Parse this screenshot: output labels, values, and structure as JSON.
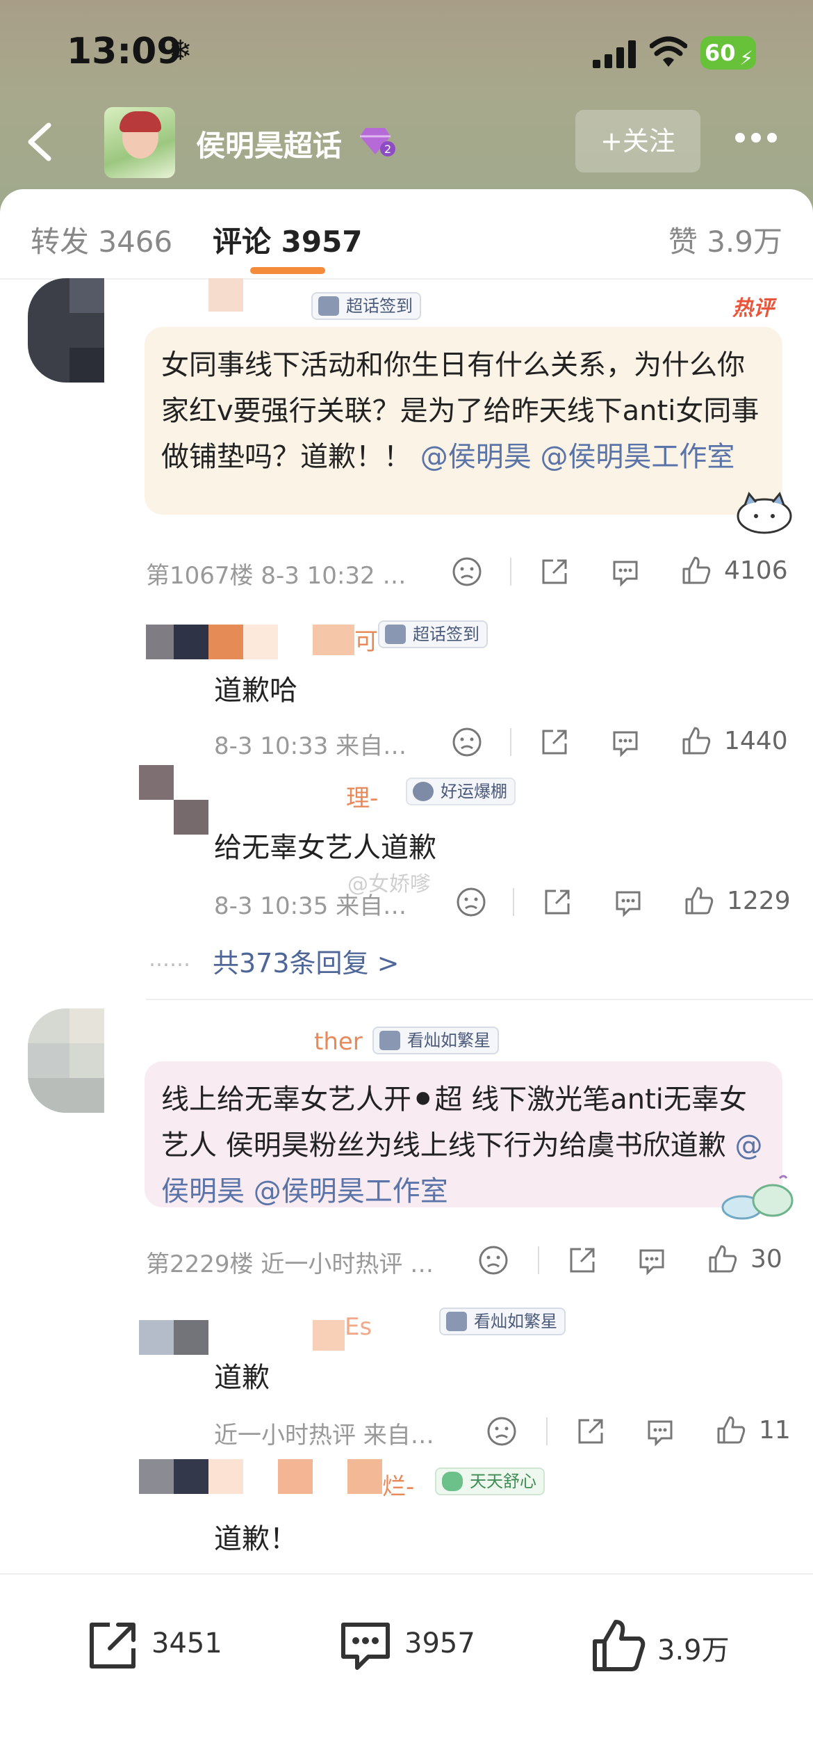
{
  "status_bar": {
    "time": "13:09",
    "battery": "60"
  },
  "header": {
    "title": "侯明昊超话",
    "follow_label": "+关注"
  },
  "tabs": {
    "repost": "转发 3466",
    "comments": "评论 3957",
    "likes": "赞 3.9万"
  },
  "comments": [
    {
      "badge": "超话签到",
      "hot_tag": "热评",
      "text": "女同事线下活动和你生日有什么关系，为什么你家红v要强行关联？是为了给昨天线下anti女同事做铺垫吗？道歉！！",
      "mentions": [
        "@侯明昊",
        "@侯明昊工作室"
      ],
      "meta": "第1067楼 8-3 10:32 …",
      "likes": "4106",
      "replies": [
        {
          "name_fragment": "可-",
          "badge": "超话签到",
          "text": "道歉哈",
          "meta": "8-3 10:33 来自…",
          "likes": "1440"
        },
        {
          "name_fragment": "理-",
          "badge": "好运爆棚",
          "text": "给无辜女艺人道歉",
          "meta": "8-3 10:35 来自…",
          "likes": "1229"
        }
      ],
      "more_replies": "共373条回复 >"
    },
    {
      "name_fragment": "ther",
      "badge": "看灿如繁星",
      "text": "线上给无辜女艺人开⚫超 线下激光笔anti无辜女艺人 侯明昊粉丝为线上线下行为给虞书欣道歉",
      "mentions": [
        "@侯明昊",
        "@侯明昊工作室"
      ],
      "meta": "第2229楼 近一小时热评 …",
      "likes": "30",
      "replies": [
        {
          "name_fragment": "Es",
          "badge": "看灿如繁星",
          "text": "道歉",
          "meta": "近一小时热评 来自…",
          "likes": "11"
        },
        {
          "name_fragment": "烂-",
          "badge": "天天舒心",
          "text": "道歉！"
        }
      ]
    }
  ],
  "watermark": "@女娇嗲",
  "bottom_bar": {
    "repost": "3451",
    "comments": "3957",
    "likes": "3.9万"
  }
}
